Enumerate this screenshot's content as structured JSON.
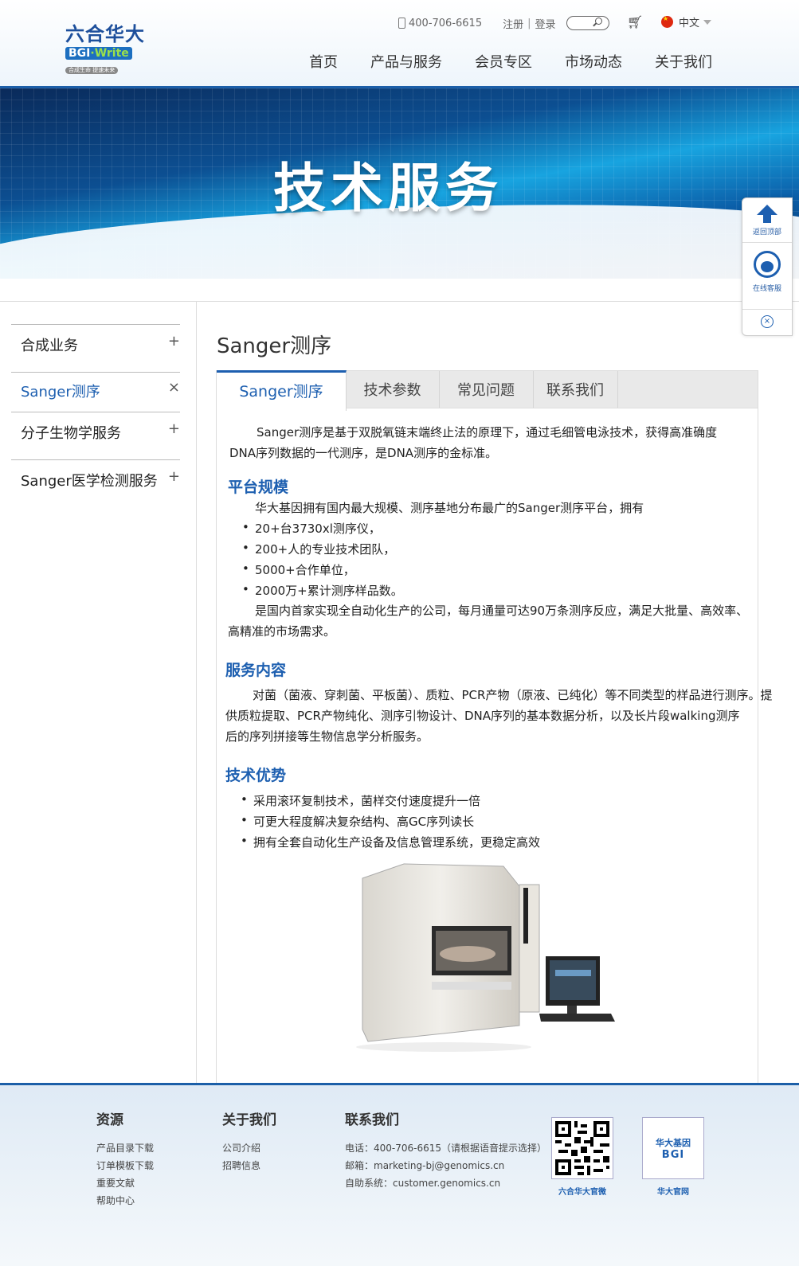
{
  "header": {
    "logo_cn": "六合华大",
    "logo_en_main": "BGI",
    "logo_en_dot": "·Write",
    "logo_tag": "合成生命 提速未来",
    "phone": "400-706-6615",
    "register": "注册",
    "login": "登录",
    "language": "中文",
    "nav": [
      "首页",
      "产品与服务",
      "会员专区",
      "市场动态",
      "关于我们"
    ]
  },
  "banner": {
    "title": "技术服务"
  },
  "side_tools": {
    "back_to_top": "返回顶部",
    "online_service": "在线客服"
  },
  "sidebar": {
    "items": [
      {
        "label": "合成业务",
        "toggle": "+"
      },
      {
        "label": "Sanger测序",
        "toggle": "×"
      },
      {
        "label": "分子生物学服务",
        "toggle": "+"
      },
      {
        "label": "Sanger医学检测服务",
        "toggle": "+"
      }
    ]
  },
  "main": {
    "title": "Sanger测序",
    "tabs": [
      "Sanger测序",
      "技术参数",
      "常见问题",
      "联系我们"
    ],
    "intro_line1": "Sanger测序是基于双脱氧链末端终止法的原理下，通过毛细管电泳技术，获得高准确度",
    "intro_line2": "DNA序列数据的一代测序，是DNA测序的金标准。",
    "platform": {
      "heading": "平台规模",
      "lead": "华大基因拥有国内最大规模、测序基地分布最广的Sanger测序平台，拥有",
      "bullets": [
        "20+台3730xl测序仪，",
        "200+人的专业技术团队，",
        "5000+合作单位，",
        "2000万+累计测序样品数。"
      ],
      "tail_line1": "是国内首家实现全自动化生产的公司，每月通量可达90万条测序反应，满足大批量、高效率、",
      "tail_line2": "高精准的市场需求。"
    },
    "service": {
      "heading": "服务内容",
      "line1": "对菌（菌液、穿刺菌、平板菌）、质粒、PCR产物（原液、已纯化）等不同类型的样品进行测序。提",
      "line2": "供质粒提取、PCR产物纯化、测序引物设计、DNA序列的基本数据分析，以及长片段walking测序",
      "line3": "后的序列拼接等生物信息学分析服务。"
    },
    "advantage": {
      "heading": "技术优势",
      "bullets": [
        "采用滚环复制技术，菌样交付速度提升一倍",
        "可更大程度解决复杂结构、高GC序列读长",
        "拥有全套自动化生产设备及信息管理系统，更稳定高效"
      ]
    }
  },
  "footer": {
    "resources": {
      "heading": "资源",
      "links": [
        "产品目录下载",
        "订单模板下载",
        "重要文献",
        "帮助中心"
      ]
    },
    "about": {
      "heading": "关于我们",
      "links": [
        "公司介绍",
        "招聘信息"
      ]
    },
    "contact": {
      "heading": "联系我们",
      "phone": "电话：400-706-6615（请根据语音提示选择）",
      "email": "邮箱：marketing-bj@genomics.cn",
      "self_service": "自助系统：customer.genomics.cn"
    },
    "qr1_caption": "六合华大官微",
    "qr2_caption": "华大官网",
    "qr2_logo_cn": "华大基因",
    "qr2_logo_en": "BGI"
  }
}
